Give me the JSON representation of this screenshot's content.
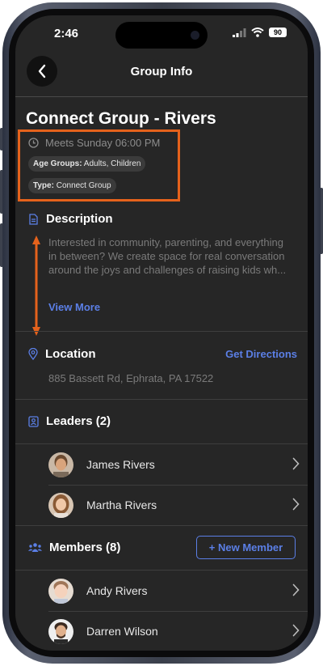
{
  "status_bar": {
    "time": "2:46",
    "battery": "90"
  },
  "header": {
    "title": "Group Info"
  },
  "group": {
    "name": "Connect Group - Rivers",
    "meets": "Meets Sunday 06:00 PM",
    "age_groups_label": "Age Groups:",
    "age_groups_value": "Adults, Children",
    "type_label": "Type:",
    "type_value": "Connect Group"
  },
  "description": {
    "heading": "Description",
    "text": "Interested in community, parenting, and everything in between? We create space for real conversation around the joys and challenges of raising kids wh...",
    "view_more": "View More"
  },
  "location": {
    "heading": "Location",
    "directions": "Get Directions",
    "address": "885 Bassett Rd, Ephrata, PA 17522"
  },
  "leaders": {
    "heading": "Leaders (2)",
    "items": [
      {
        "name": "James Rivers"
      },
      {
        "name": "Martha Rivers"
      }
    ]
  },
  "members": {
    "heading": "Members (8)",
    "new_member": "+ New Member",
    "items": [
      {
        "name": "Andy Rivers"
      },
      {
        "name": "Darren Wilson"
      }
    ]
  },
  "colors": {
    "accent": "#5b7fe6",
    "annotation": "#e5621c",
    "background": "#262626"
  },
  "icons": [
    "back-chevron-icon",
    "clock-icon",
    "document-icon",
    "map-pin-icon",
    "contact-card-icon",
    "group-icon",
    "chevron-right-icon",
    "signal-icon",
    "wifi-icon",
    "battery-icon"
  ]
}
